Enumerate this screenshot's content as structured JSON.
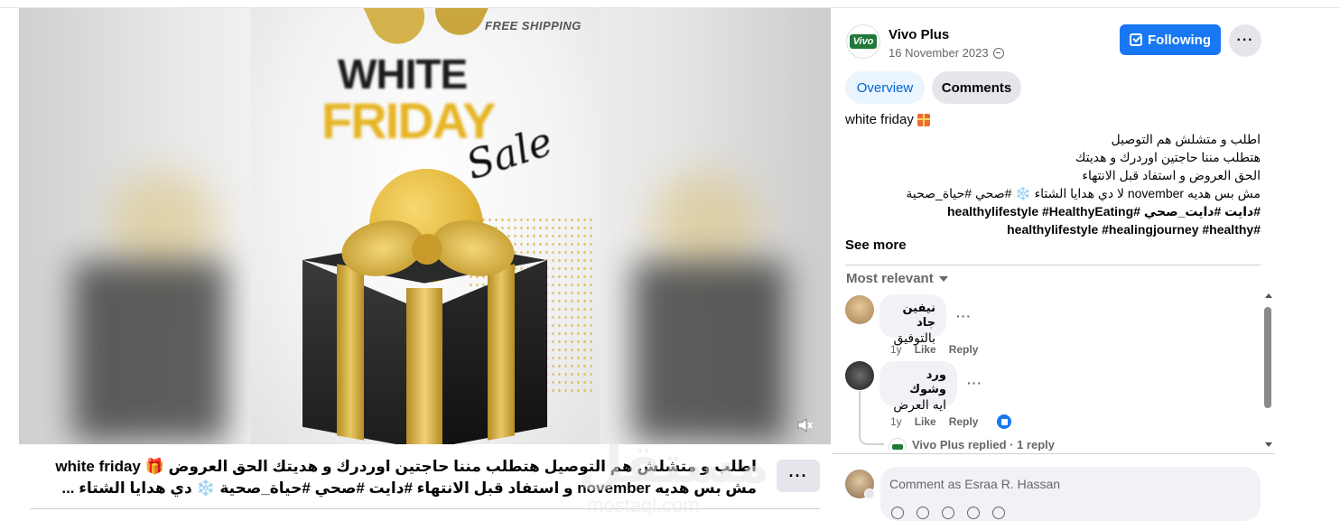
{
  "video": {
    "poster_free_shipping": "FREE SHIPPING",
    "poster_word1": "WHITE",
    "poster_word2": "FRIDAY",
    "poster_word3": "Sale"
  },
  "caption": {
    "line1": "اطلب و متشلش هم التوصيل هتطلب مننا حاجتين اوردرك و هديتك الحق العروض 🎁 white friday",
    "line2": "مش بس هديه november و استفاد قبل الانتهاء #دايت #صحي #حياة_صحية ❄️ دي هدايا الشتاء ...",
    "more_label": "···"
  },
  "watermark": {
    "main": "مستقل",
    "sub": "mostaql.com"
  },
  "post": {
    "page_name": "Vivo Plus",
    "logo_text": "Vivo",
    "date": "16 November 2023",
    "following_label": "Following",
    "more_label": "···"
  },
  "tabs": {
    "overview": "Overview",
    "comments": "Comments"
  },
  "description": {
    "title": "white friday",
    "lines": [
      "اطلب و متشلش هم التوصيل",
      "هتطلب مننا حاجتين اوردرك و هديتك",
      "الحق العروض و استفاد قبل الانتهاء",
      "مش بس هديه november لا دي هدايا الشتاء ❄️ #صحي #حياة_صحية",
      "#دايت #دايت_صحي #healthylifestyle #HealthyEating",
      "#healthylifestyle #healingjourney #healthy"
    ],
    "see_more": "See more"
  },
  "comments_header": {
    "sort_label": "Most relevant"
  },
  "comments": [
    {
      "author": "نيفين جاد",
      "text": "بالتوفيق",
      "time": "1y",
      "like": "Like",
      "reply": "Reply",
      "more": "···"
    },
    {
      "author": "ورد وشوك",
      "text": "ايه العرض",
      "time": "1y",
      "like": "Like",
      "reply": "Reply",
      "more": "···"
    }
  ],
  "reply_summary": "Vivo Plus replied · 1 reply",
  "comment_input": {
    "placeholder": "Comment as Esraa R. Hassan"
  },
  "colors": {
    "accent": "#1877f2",
    "poster_gold": "#e6b422"
  },
  "icons": [
    "globe-icon",
    "following-check-icon",
    "gift-icon",
    "caret-down-icon",
    "mute-icon",
    "like-reaction-icon"
  ]
}
